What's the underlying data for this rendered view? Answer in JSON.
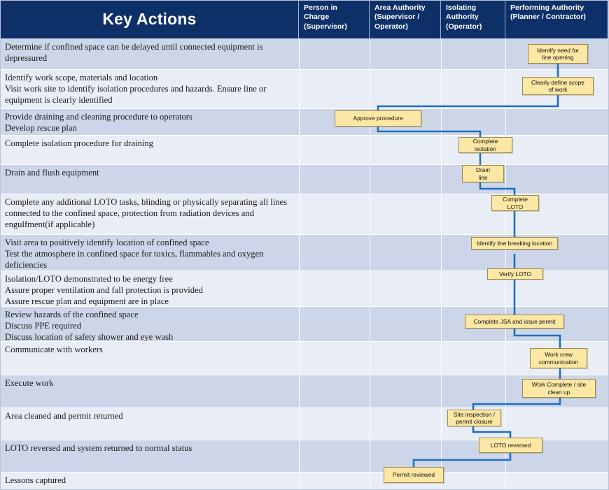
{
  "header": {
    "title": "Key Actions",
    "columns": [
      "Person in Charge (Supervisor)",
      "Area Authority (Supervisor / Operator)",
      "Isolating Authority (Operator)",
      "Performing Authority (Planner / Contractor)"
    ],
    "column_lines": [
      [
        "Person in",
        "Charge",
        "(Supervisor)"
      ],
      [
        "Area Authority",
        "(Supervisor /",
        "Operator)"
      ],
      [
        "Isolating",
        "Authority",
        "(Operator)"
      ],
      [
        "Performing Authority",
        "(Planner / Contractor)"
      ]
    ]
  },
  "colors": {
    "header_background": "#0e3068",
    "header_text": "#ffffff",
    "band_a": "#ccd6e8",
    "band_b": "#e9edf6",
    "box_fill": "#fce7a4",
    "box_border": "#9a8a4e",
    "connector": "#1f6fc0",
    "grid_line": "#ffffff"
  },
  "chart_data": {
    "type": "diagram",
    "title": "Key Actions",
    "subtype": "swimlane-flowchart",
    "lanes": [
      "Key Actions",
      "Person in Charge (Supervisor)",
      "Area Authority (Supervisor / Operator)",
      "Isolating Authority (Operator)",
      "Performing Authority (Planner / Contractor)"
    ],
    "rows": [
      {
        "index": 1,
        "lines": [
          "Determine if confined space can be delayed until connected equipment is",
          "depressured"
        ]
      },
      {
        "index": 2,
        "lines": [
          "Identify work scope, materials and location",
          "Visit work site to identify isolation procedures and hazards.  Ensure line or",
          "equipment is clearly identified"
        ]
      },
      {
        "index": 3,
        "lines": [
          "Provide draining and cleaning procedure to operators",
          "Develop rescue plan"
        ]
      },
      {
        "index": 4,
        "lines": [
          "Complete isolation procedure for draining"
        ]
      },
      {
        "index": 5,
        "lines": [
          "Drain and  flush equipment"
        ]
      },
      {
        "index": 6,
        "lines": [
          "Complete any additional LOTO tasks, blinding or physically separating all lines",
          "connected to the confined space, protection from radiation devices and",
          "engulfment(if applicable)"
        ]
      },
      {
        "index": 7,
        "lines": [
          "Visit area to positively identify location of confined space",
          "Test the atmosphere in confined space for toxics, flammables and oxygen",
          "deficiencies"
        ]
      },
      {
        "index": 8,
        "lines": [
          "Isolation/LOTO demonstrated to be energy free",
          "Assure proper ventilation and fall protection is provided",
          "Assure rescue plan and equipment are in place"
        ]
      },
      {
        "index": 9,
        "lines": [
          "Review hazards  of the confined space",
          "Discuss PPE required",
          "Discuss location of safety shower and eye wash"
        ]
      },
      {
        "index": 10,
        "lines": [
          "Communicate with workers"
        ]
      },
      {
        "index": 11,
        "lines": [
          "Execute work"
        ]
      },
      {
        "index": 12,
        "lines": [
          "Area cleaned and permit returned"
        ]
      },
      {
        "index": 13,
        "lines": [
          "LOTO reversed and system returned to normal status"
        ]
      },
      {
        "index": 14,
        "lines": [
          "Lessons captured"
        ]
      }
    ],
    "nodes": [
      {
        "id": "n1",
        "lines": [
          "Identify need for",
          "line opening"
        ],
        "lane": "Performing Authority (Planner / Contractor)",
        "row": 1
      },
      {
        "id": "n2",
        "lines": [
          "Clearly define scope",
          "of work"
        ],
        "lane": "Performing Authority (Planner / Contractor)",
        "row": 2
      },
      {
        "id": "n3",
        "lines": [
          "Approve procedure"
        ],
        "lane": "Area Authority (Supervisor / Operator)",
        "row": 3
      },
      {
        "id": "n4",
        "lines": [
          "Complete",
          "isolation"
        ],
        "lane": "Isolating Authority (Operator)",
        "row": 4
      },
      {
        "id": "n5",
        "lines": [
          "Drain",
          "line"
        ],
        "lane": "Isolating Authority (Operator)",
        "row": 5
      },
      {
        "id": "n6",
        "lines": [
          "Complete",
          "LOTO"
        ],
        "lane": "Isolating Authority (Operator)",
        "row": 6
      },
      {
        "id": "n7",
        "lines": [
          "Identify line breaking location"
        ],
        "lane": "Isolating Authority (Operator)",
        "row": 7
      },
      {
        "id": "n8",
        "lines": [
          "Verify LOTO"
        ],
        "lane": "Isolating Authority (Operator)",
        "row": 8
      },
      {
        "id": "n9",
        "lines": [
          "Complete JSA and issue permit"
        ],
        "lane": "Isolating Authority (Operator)",
        "row": 9
      },
      {
        "id": "n10",
        "lines": [
          "Work crew",
          "communication"
        ],
        "lane": "Performing Authority (Planner / Contractor)",
        "row": 10
      },
      {
        "id": "n11",
        "lines": [
          "Work Complete / site",
          "clean up"
        ],
        "lane": "Performing Authority (Planner / Contractor)",
        "row": 11
      },
      {
        "id": "n12",
        "lines": [
          "Site inspection /",
          "permit closure"
        ],
        "lane": "Isolating Authority (Operator)",
        "row": 12
      },
      {
        "id": "n13",
        "lines": [
          "LOTO reversed"
        ],
        "lane": "Isolating Authority (Operator)",
        "row": 13
      },
      {
        "id": "n14",
        "lines": [
          "Permit reviewed"
        ],
        "lane": "Area Authority (Supervisor / Operator)",
        "row": 14
      }
    ],
    "edges": [
      {
        "from": "n1",
        "to": "n2"
      },
      {
        "from": "n2",
        "to": "n3"
      },
      {
        "from": "n3",
        "to": "n4"
      },
      {
        "from": "n4",
        "to": "n5"
      },
      {
        "from": "n5",
        "to": "n6"
      },
      {
        "from": "n6",
        "to": "n7"
      },
      {
        "from": "n7",
        "to": "n8"
      },
      {
        "from": "n8",
        "to": "n9"
      },
      {
        "from": "n9",
        "to": "n10"
      },
      {
        "from": "n10",
        "to": "n11"
      },
      {
        "from": "n11",
        "to": "n12"
      },
      {
        "from": "n12",
        "to": "n13"
      },
      {
        "from": "n13",
        "to": "n14"
      }
    ]
  }
}
